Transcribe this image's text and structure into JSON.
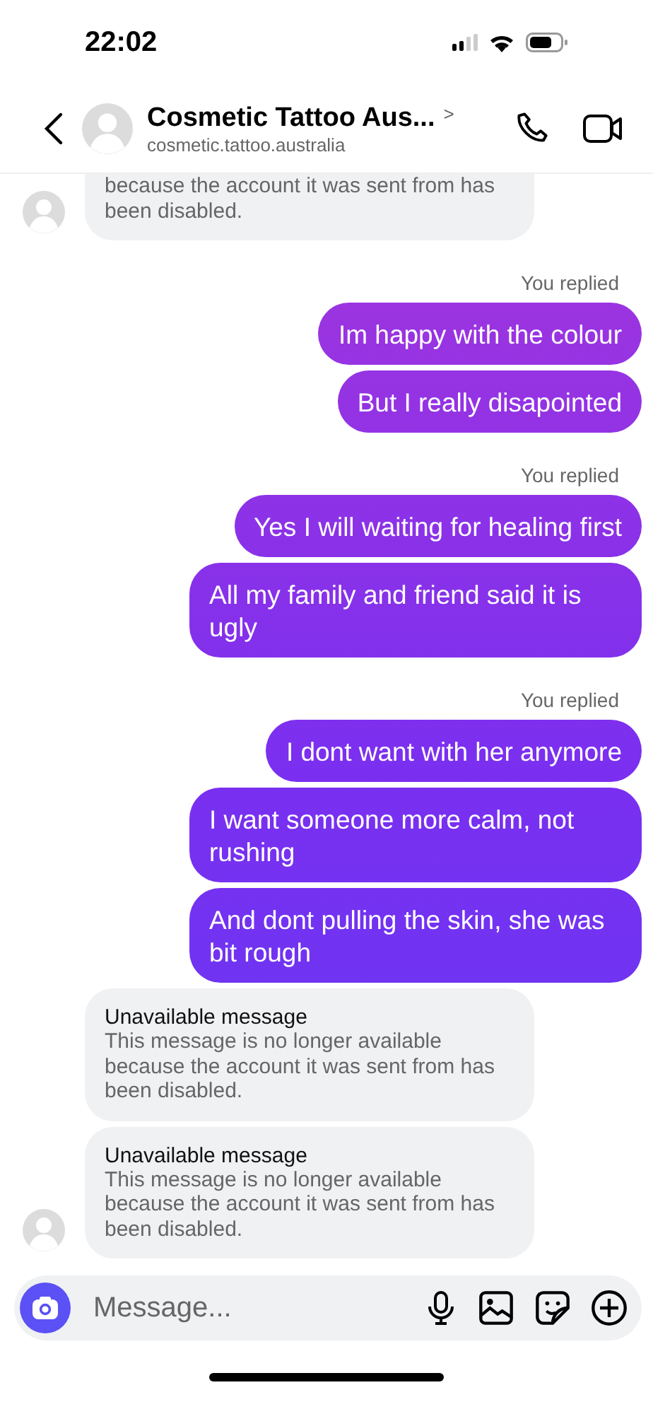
{
  "status_bar": {
    "time": "22:02"
  },
  "header": {
    "name": "Cosmetic Tattoo Aus...",
    "chevron": ">",
    "username": "cosmetic.tattoo.australia"
  },
  "messages": [
    {
      "kind": "unavailable",
      "body": "because the account it was sent from has been disabled.",
      "show_avatar": true
    },
    {
      "kind": "label",
      "text": "You replied"
    },
    {
      "kind": "sent",
      "text": "Im happy with the colour"
    },
    {
      "kind": "sent",
      "text": "But I really disapointed"
    },
    {
      "kind": "label",
      "text": "You replied"
    },
    {
      "kind": "sent",
      "text": "Yes I will waiting for healing first"
    },
    {
      "kind": "sent",
      "text": "All my family and friend said it is ugly"
    },
    {
      "kind": "label",
      "text": "You replied"
    },
    {
      "kind": "sent",
      "text": "I dont want with her anymore"
    },
    {
      "kind": "sent",
      "text": "I want someone more calm, not rushing"
    },
    {
      "kind": "sent",
      "text": "And dont pulling the skin, she was bit rough"
    },
    {
      "kind": "unavailable",
      "title": "Unavailable message",
      "body": "This message is no longer available because the account it was sent from has been disabled.",
      "show_avatar": false
    },
    {
      "kind": "unavailable",
      "title": "Unavailable message",
      "body": "This message is no longer available because the account it was sent from has been disabled.",
      "show_avatar": true
    }
  ],
  "composer": {
    "placeholder": "Message..."
  }
}
